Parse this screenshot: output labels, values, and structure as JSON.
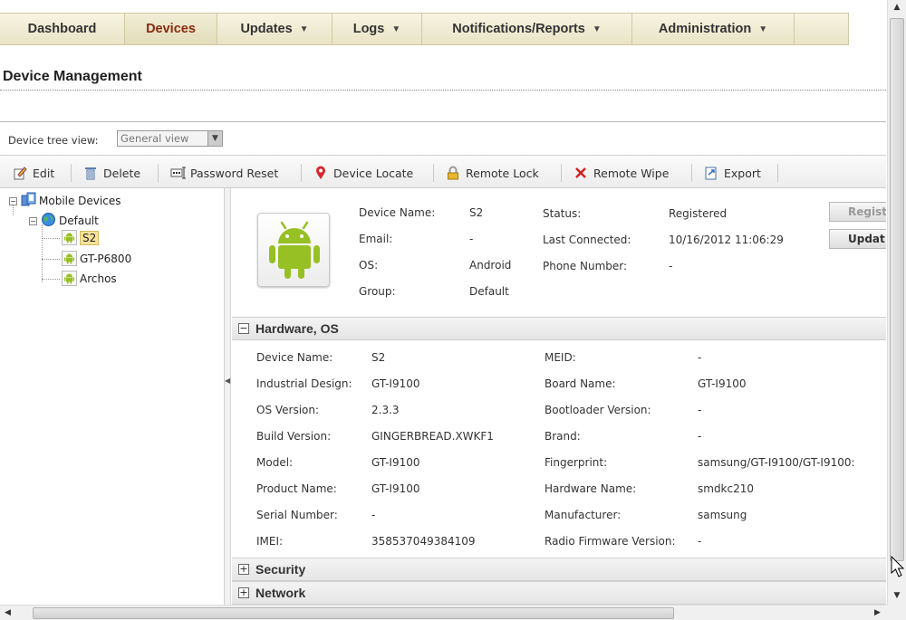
{
  "nav": {
    "items": [
      {
        "label": "Dashboard",
        "caret": false,
        "active": false
      },
      {
        "label": "Devices",
        "caret": false,
        "active": true
      },
      {
        "label": "Updates",
        "caret": true,
        "active": false
      },
      {
        "label": "Logs",
        "caret": true,
        "active": false
      },
      {
        "label": "Notifications/Reports",
        "caret": true,
        "active": false
      },
      {
        "label": "Administration",
        "caret": true,
        "active": false
      }
    ],
    "caret_glyph": "▼"
  },
  "page": {
    "title": "Device Management"
  },
  "treeview": {
    "label": "Device tree view:",
    "selected": "General view"
  },
  "toolbar": {
    "edit": "Edit",
    "delete": "Delete",
    "password_reset": "Password Reset",
    "device_locate": "Device Locate",
    "remote_lock": "Remote Lock",
    "remote_wipe": "Remote Wipe",
    "export": "Export"
  },
  "tree": {
    "root": "Mobile Devices",
    "group": "Default",
    "devices": [
      "S2",
      "GT-P6800",
      "Archos"
    ],
    "selected": "S2"
  },
  "summary": {
    "device_name_label": "Device Name:",
    "device_name": "S2",
    "email_label": "Email:",
    "email": "-",
    "os_label": "OS:",
    "os": "Android",
    "group_label": "Group:",
    "group": "Default",
    "status_label": "Status:",
    "status": "Registered",
    "last_connected_label": "Last Connected:",
    "last_connected": "10/16/2012 11:06:29",
    "phone_label": "Phone Number:",
    "phone": "-",
    "btn_register": "Regist",
    "btn_update": "Updat"
  },
  "sections": {
    "hardware": "Hardware, OS",
    "security": "Security",
    "network": "Network",
    "collapse_glyph": "−",
    "expand_glyph": "+"
  },
  "hardware": {
    "left": [
      {
        "label": "Device Name:",
        "value": "S2"
      },
      {
        "label": "Industrial Design:",
        "value": "GT-I9100"
      },
      {
        "label": "OS Version:",
        "value": "2.3.3"
      },
      {
        "label": "Build Version:",
        "value": "GINGERBREAD.XWKF1"
      },
      {
        "label": "Model:",
        "value": "GT-I9100"
      },
      {
        "label": "Product Name:",
        "value": "GT-I9100"
      },
      {
        "label": "Serial Number:",
        "value": "-"
      },
      {
        "label": "IMEI:",
        "value": "358537049384109"
      }
    ],
    "right": [
      {
        "label": "MEID:",
        "value": "-"
      },
      {
        "label": "Board Name:",
        "value": "GT-I9100"
      },
      {
        "label": "Bootloader Version:",
        "value": "-"
      },
      {
        "label": "Brand:",
        "value": "-"
      },
      {
        "label": "Fingerprint:",
        "value": "samsung/GT-I9100/GT-I9100:"
      },
      {
        "label": "Hardware Name:",
        "value": "smdkc210"
      },
      {
        "label": "Manufacturer:",
        "value": "samsung"
      },
      {
        "label": "Radio Firmware Version:",
        "value": "-"
      }
    ]
  },
  "colors": {
    "active_nav": "#8b2a10",
    "android_green": "#97c024",
    "nav_bg": "#efebd3"
  }
}
